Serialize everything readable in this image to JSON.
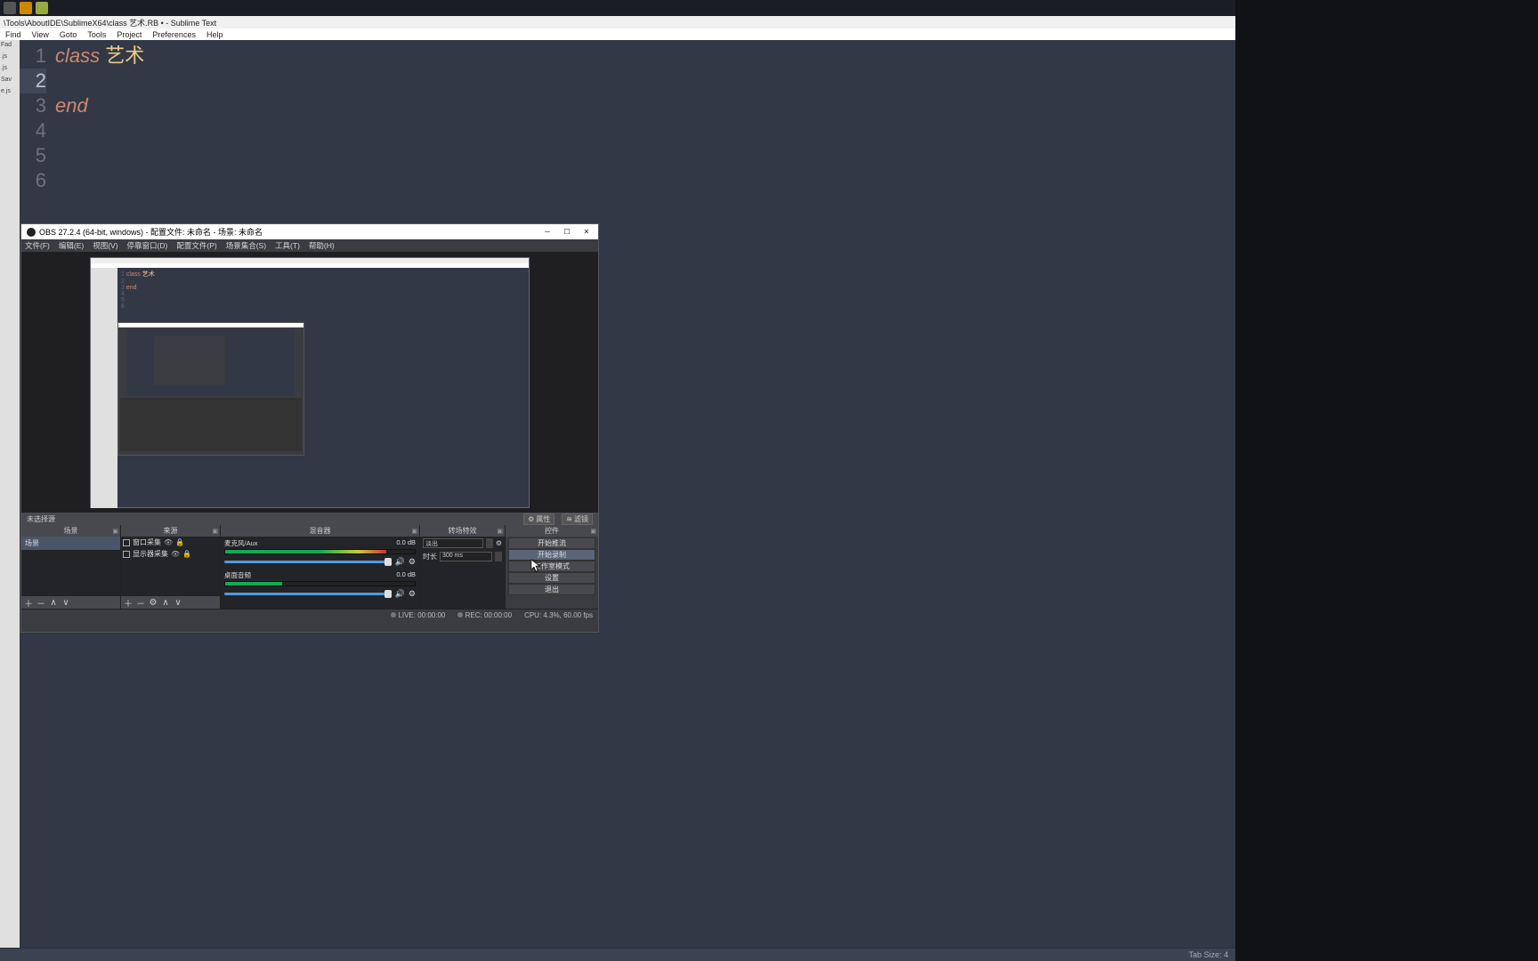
{
  "sublime": {
    "title_path": "\\Tools\\AboutIDE\\SublimeX64\\class 艺术.RB • - Sublime Text",
    "menu": [
      "Find",
      "View",
      "Goto",
      "Tools",
      "Project",
      "Preferences",
      "Help"
    ],
    "sidebar_items": [
      "Fad",
      ".js",
      ".js",
      "Sav",
      "e.js"
    ],
    "code": {
      "lines": [
        "1",
        "2",
        "3",
        "4",
        "5",
        "6"
      ],
      "l1_kw": "class",
      "l1_cls": "艺术",
      "l3_kw": "end"
    },
    "status": {
      "tab_size": "Tab Size: 4"
    }
  },
  "obs": {
    "title": "OBS 27.2.4 (64-bit, windows) - 配置文件: 未命名 - 场景: 未命名",
    "menu": [
      "文件(F)",
      "编辑(E)",
      "视图(V)",
      "停靠窗口(D)",
      "配置文件(P)",
      "场景集合(S)",
      "工具(T)",
      "帮助(H)"
    ],
    "toolbar": {
      "no_select": "未选择源",
      "props": "属性",
      "filters": "滤镜"
    },
    "docks": {
      "scenes": {
        "title": "场景",
        "items": [
          "场景"
        ]
      },
      "sources": {
        "title": "来源",
        "items": [
          {
            "icon": "window",
            "label": "窗口采集"
          },
          {
            "icon": "display",
            "label": "显示器采集"
          }
        ]
      },
      "mixer": {
        "title": "混音器",
        "channels": [
          {
            "name": "麦克风/Aux",
            "db": "0.0 dB"
          },
          {
            "name": "桌面音频",
            "db": "0.0 dB"
          }
        ]
      },
      "transitions": {
        "title": "转场特效",
        "type": "淡出",
        "dur_label": "时长",
        "dur_val": "300 ms"
      },
      "controls": {
        "title": "控件",
        "buttons": [
          "开始推流",
          "开始录制",
          "工作室模式",
          "设置",
          "退出"
        ]
      }
    },
    "status": {
      "live": "LIVE: 00:00:00",
      "rec": "REC: 00:00:00",
      "cpu": "CPU: 4.3%, 60.00 fps"
    },
    "preview_code": {
      "l1": "1 class 艺术",
      "l2": "2",
      "l3": "3 end",
      "l4": "4",
      "l5": "5",
      "l6": "6"
    }
  }
}
